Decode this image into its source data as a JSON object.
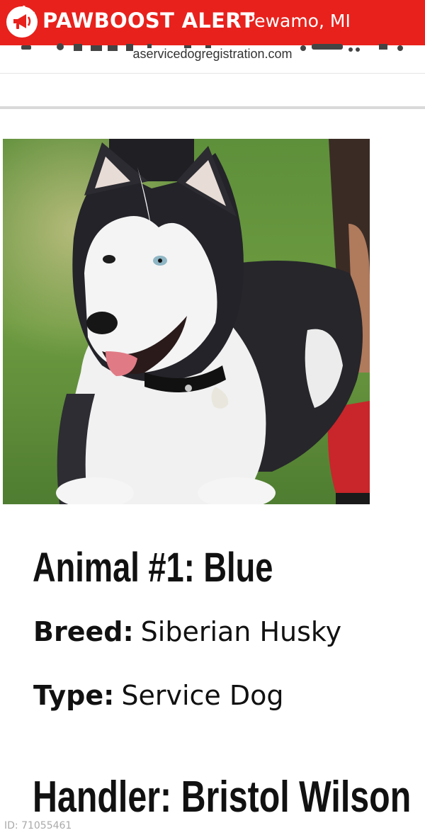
{
  "alert": {
    "brand": "PAWBOOST ALERT",
    "location": "Pewamo, MI",
    "icon": "megaphone-icon",
    "color": "#e8211c"
  },
  "browser": {
    "url": "aservicedogregistration.com"
  },
  "photo": {
    "subject": "husky-photo"
  },
  "animal": {
    "heading": "Animal #1: Blue",
    "breed_label": "Breed:",
    "breed_value": "Siberian Husky",
    "type_label": "Type:",
    "type_value": "Service Dog"
  },
  "handler": {
    "heading": "Handler: Bristol Wilson"
  },
  "footer": {
    "id_text": "ID: 71055461"
  }
}
